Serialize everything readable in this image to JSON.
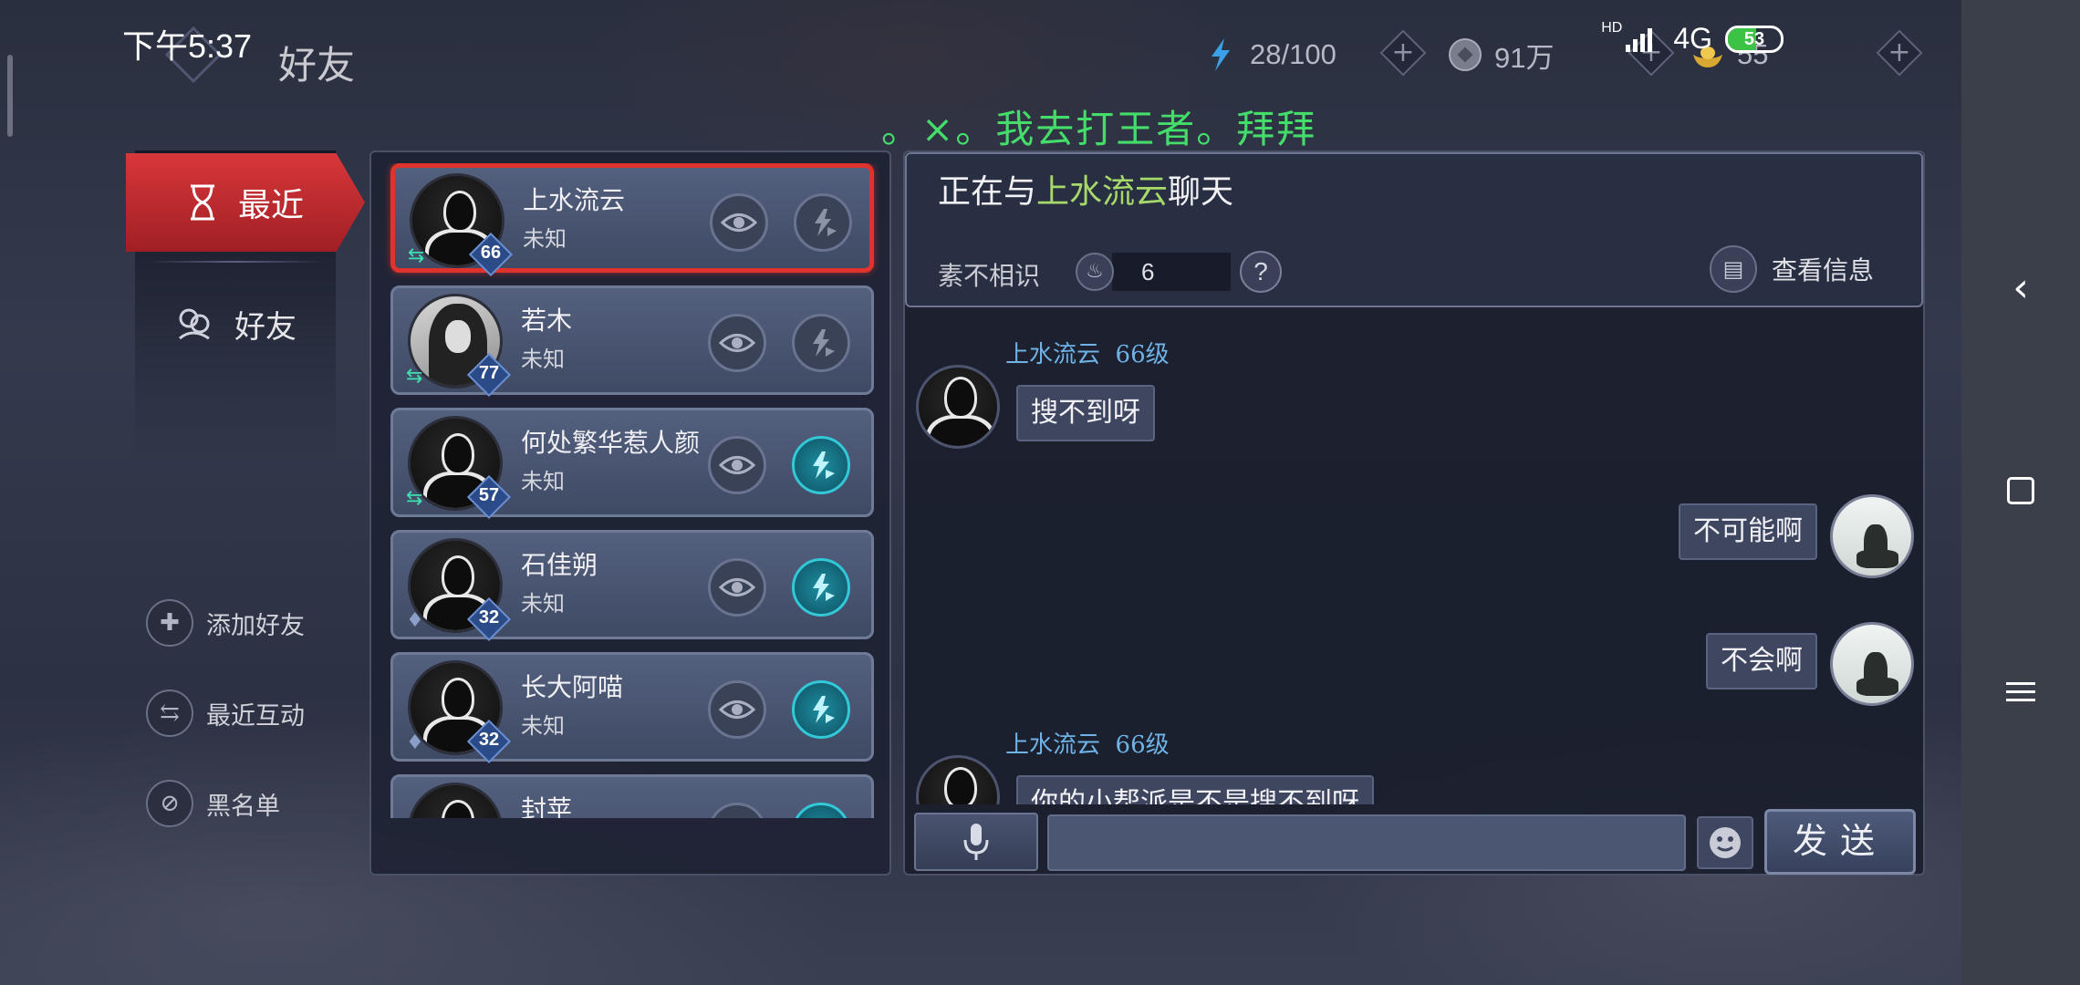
{
  "status_bar": {
    "time": "下午5:37",
    "network": "4G",
    "hd": "HD",
    "battery": "53",
    "battery_level": 0.53
  },
  "header": {
    "title": "好友",
    "stamina": "28/100",
    "coins": "91万",
    "gold": "55"
  },
  "marquee": "。×。我去打王者。拜拜",
  "left_menu": {
    "tabs": [
      {
        "label": "最近",
        "icon": "hourglass-icon",
        "active": true
      },
      {
        "label": "好友",
        "icon": "friends-icon",
        "active": false
      }
    ],
    "actions": [
      {
        "label": "添加好友",
        "icon": "add-friend-icon"
      },
      {
        "label": "最近互动",
        "icon": "swap-icon"
      },
      {
        "label": "黑名单",
        "icon": "blacklist-icon"
      }
    ]
  },
  "friends": [
    {
      "name": "上水流云",
      "status": "未知",
      "level": "66",
      "avatar": "silhouette",
      "badge": "swap",
      "gift_ready": false,
      "active": true
    },
    {
      "name": "若木",
      "status": "未知",
      "level": "77",
      "avatar": "photo",
      "badge": "swap",
      "gift_ready": false,
      "active": false
    },
    {
      "name": "何处繁华惹人颜",
      "status": "未知",
      "level": "57",
      "avatar": "silhouette",
      "badge": "swap",
      "gift_ready": true,
      "active": false
    },
    {
      "name": "石佳朔",
      "status": "未知",
      "level": "32",
      "avatar": "silhouette",
      "badge": "figure",
      "gift_ready": true,
      "active": false
    },
    {
      "name": "长大阿喵",
      "status": "未知",
      "level": "32",
      "avatar": "silhouette",
      "badge": "figure",
      "gift_ready": true,
      "active": false
    },
    {
      "name": "封苹",
      "status": "",
      "level": "",
      "avatar": "silhouette",
      "badge": "",
      "gift_ready": true,
      "active": false
    }
  ],
  "chat": {
    "title_prefix": "正在与",
    "partner": "上水流云",
    "title_suffix": "聊天",
    "relation_label": "素不相识",
    "relation_value": "6",
    "help": "?",
    "view_info": "查看信息",
    "messages": [
      {
        "from": "other",
        "sender": "上水流云",
        "sender_level": "66级",
        "text": "搜不到呀"
      },
      {
        "from": "self",
        "text": "不可能啊"
      },
      {
        "from": "self",
        "text": "不会啊"
      },
      {
        "from": "other",
        "sender": "上水流云",
        "sender_level": "66级",
        "text": "你的小帮派是不是搜不到呀"
      }
    ],
    "input_value": "",
    "send_label": "发送"
  },
  "colors": {
    "accent_red": "#d8373a",
    "partner_green": "#a6d86a",
    "sender_blue": "#6eb2e6",
    "marquee_green": "#44dd6a"
  }
}
